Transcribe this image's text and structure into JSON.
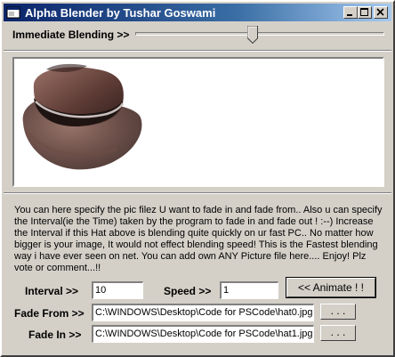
{
  "window": {
    "title": "Alpha Blender by Tushar Goswami",
    "controls": {
      "minimize_icon": "minimize-icon",
      "maximize_icon": "maximize-icon",
      "close_icon": "close-icon"
    }
  },
  "blend": {
    "label": "Immediate Blending >>",
    "slider_level": 0.47
  },
  "picture": {
    "icon": "hat-image"
  },
  "description": "You can here specify the pic filez U want to fade in and fade from.. Also u can specify the Interval(ie the Time) taken by the program to fade in and fade out ! :--) Increase the Interval if this Hat above is blending quite quickly on ur fast PC.. No matter how bigger is your image, It would not effect blending speed! This is the Fastest blending way i have ever seen on net. You can add own ANY Picture file here.... Enjoy! Plz vote or comment...!!",
  "form": {
    "interval_label": "Interval  >>",
    "interval_value": "10",
    "speed_label": "Speed >>",
    "speed_value": "1",
    "animate_label": "<< Animate ! !",
    "fade_from_label": "Fade From >>",
    "fade_from_value": "C:\\WINDOWS\\Desktop\\Code for PSCode\\hat0.jpg",
    "fade_in_label": "Fade In >>",
    "fade_in_value": "C:\\WINDOWS\\Desktop\\Code for PSCode\\hat1.jpg",
    "browse_label": ". . ."
  }
}
